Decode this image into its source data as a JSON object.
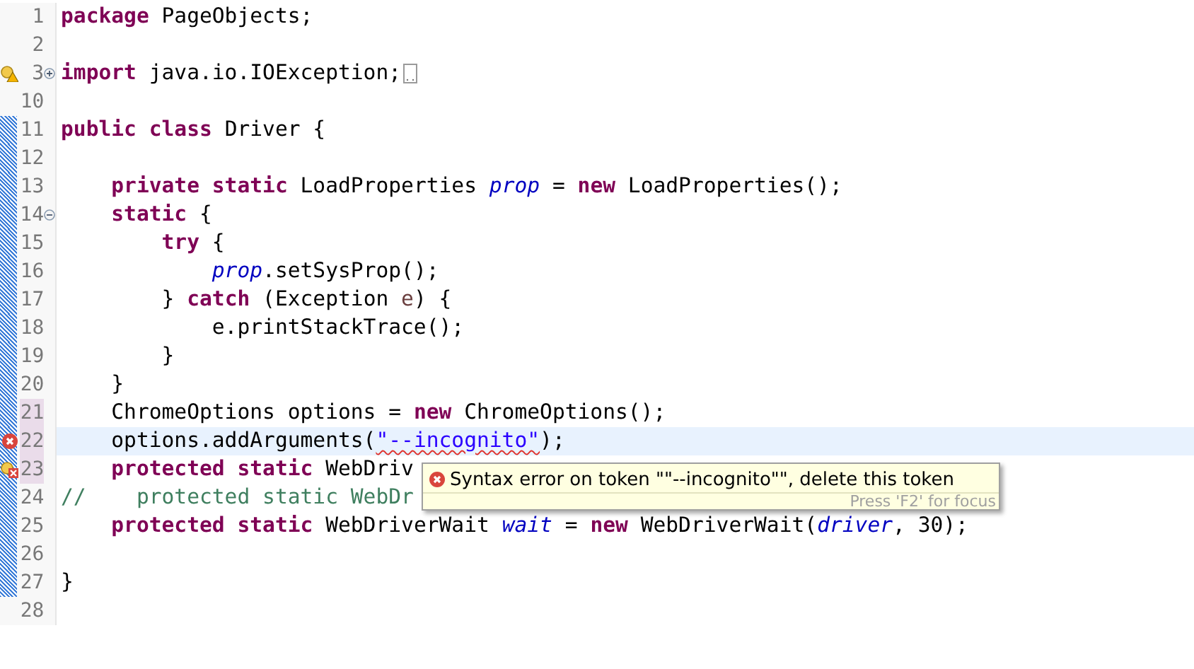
{
  "editor": {
    "lines": [
      {
        "number": "1",
        "tokens": [
          {
            "kind": "keyword",
            "text": "package"
          },
          {
            "kind": "plain",
            "text": " PageObjects;"
          }
        ]
      },
      {
        "number": "2"
      },
      {
        "number": "3",
        "warning": true,
        "quick_fix": true,
        "expanded": false,
        "folded": true,
        "tokens": [
          {
            "kind": "keyword",
            "text": "import"
          },
          {
            "kind": "plain",
            "text": " java.io.IOException;"
          }
        ]
      },
      {
        "number": "10"
      },
      {
        "number": "11",
        "changed": true,
        "tokens": [
          {
            "kind": "keyword",
            "text": "public class"
          },
          {
            "kind": "plain",
            "text": " Driver {"
          }
        ]
      },
      {
        "number": "12",
        "changed": true
      },
      {
        "number": "13",
        "changed": true,
        "tokens": [
          {
            "kind": "keyword",
            "text": "    private static"
          },
          {
            "kind": "plain",
            "text": " LoadProperties "
          },
          {
            "kind": "field",
            "text": "prop"
          },
          {
            "kind": "plain",
            "text": " = "
          },
          {
            "kind": "keyword",
            "text": "new"
          },
          {
            "kind": "plain",
            "text": " LoadProperties();"
          }
        ]
      },
      {
        "number": "14",
        "changed": true,
        "expanded": true,
        "tokens": [
          {
            "kind": "keyword",
            "text": "    static"
          },
          {
            "kind": "plain",
            "text": " {"
          }
        ]
      },
      {
        "number": "15",
        "changed": true,
        "tokens": [
          {
            "kind": "keyword",
            "text": "        try"
          },
          {
            "kind": "plain",
            "text": " {"
          }
        ]
      },
      {
        "number": "16",
        "changed": true,
        "tokens": [
          {
            "kind": "field",
            "text": "            prop"
          },
          {
            "kind": "plain",
            "text": ".setSysProp();"
          }
        ]
      },
      {
        "number": "17",
        "changed": true,
        "tokens": [
          {
            "kind": "plain",
            "text": "        } "
          },
          {
            "kind": "keyword",
            "text": "catch"
          },
          {
            "kind": "plain",
            "text": " (Exception "
          },
          {
            "kind": "local",
            "text": "e"
          },
          {
            "kind": "plain",
            "text": ") {"
          }
        ]
      },
      {
        "number": "18",
        "changed": true,
        "tokens": [
          {
            "kind": "plain",
            "text": "            e.printStackTrace();"
          }
        ]
      },
      {
        "number": "19",
        "changed": true,
        "tokens": [
          {
            "kind": "plain",
            "text": "        }"
          }
        ]
      },
      {
        "number": "20",
        "changed": true,
        "tokens": [
          {
            "kind": "plain",
            "text": "    }"
          }
        ]
      },
      {
        "number": "21",
        "changed": true,
        "marked": true,
        "tokens": [
          {
            "kind": "plain",
            "text": "    ChromeOptions options = "
          },
          {
            "kind": "keyword",
            "text": "new"
          },
          {
            "kind": "plain",
            "text": " ChromeOptions();"
          }
        ]
      },
      {
        "number": "22",
        "changed": true,
        "marked": true,
        "current": true,
        "error": true,
        "tokens": [
          {
            "kind": "plain",
            "text": "    options.addArguments("
          },
          {
            "kind": "string",
            "text": "\"--incognito\"",
            "squiggle": true
          },
          {
            "kind": "plain",
            "text": ");"
          }
        ]
      },
      {
        "number": "23",
        "changed": true,
        "marked": true,
        "error": true,
        "quick_fix": true,
        "tokens": [
          {
            "kind": "keyword",
            "text": "    protected static"
          },
          {
            "kind": "plain",
            "text": " WebDriv"
          }
        ]
      },
      {
        "number": "24",
        "changed": true,
        "tokens": [
          {
            "kind": "comment",
            "text": "//    protected static WebDr"
          }
        ]
      },
      {
        "number": "25",
        "changed": true,
        "tokens": [
          {
            "kind": "keyword",
            "text": "    protected static"
          },
          {
            "kind": "plain",
            "text": " WebDriverWait "
          },
          {
            "kind": "field",
            "text": "wait"
          },
          {
            "kind": "plain",
            "text": " = "
          },
          {
            "kind": "keyword",
            "text": "new"
          },
          {
            "kind": "plain",
            "text": " WebDriverWait("
          },
          {
            "kind": "field",
            "text": "driver"
          },
          {
            "kind": "plain",
            "text": ", 30);"
          }
        ]
      },
      {
        "number": "26",
        "changed": true
      },
      {
        "number": "27",
        "changed": true,
        "tokens": [
          {
            "kind": "plain",
            "text": "}"
          }
        ]
      },
      {
        "number": "28"
      }
    ]
  },
  "tooltip": {
    "message": "Syntax error on token \"\"--incognito\"\", delete this token",
    "hint": "Press 'F2' for focus"
  }
}
